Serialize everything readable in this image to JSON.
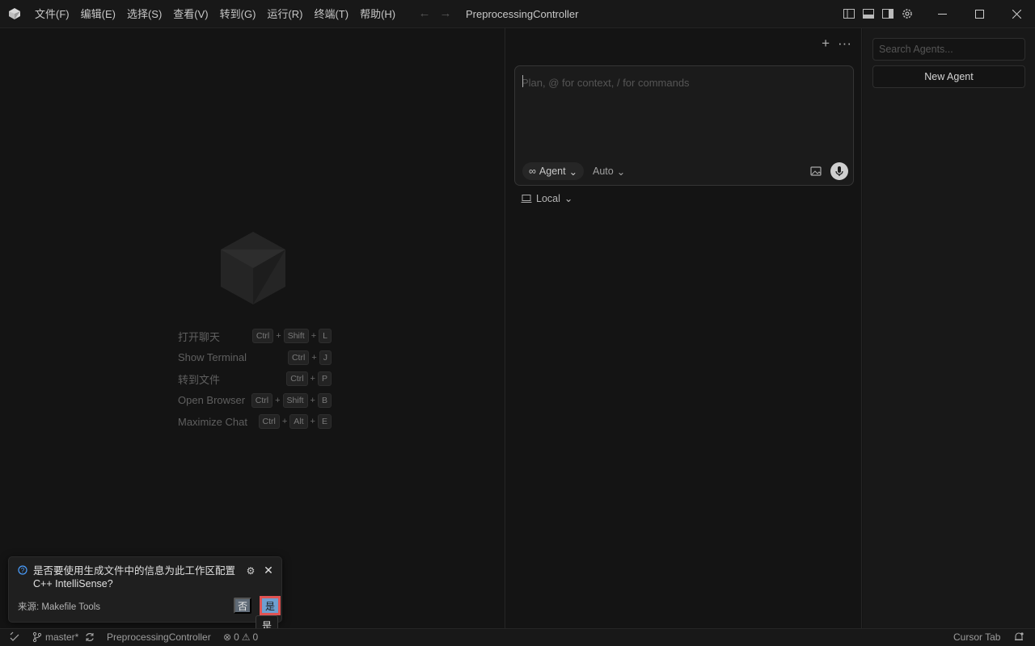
{
  "menu": {
    "items": [
      "文件(F)",
      "编辑(E)",
      "选择(S)",
      "查看(V)",
      "转到(G)",
      "运行(R)",
      "终端(T)",
      "帮助(H)"
    ]
  },
  "window": {
    "title": "PreprocessingController"
  },
  "welcome": {
    "shortcuts": [
      {
        "label": "打开聊天",
        "keys": [
          "Ctrl",
          "Shift",
          "L"
        ]
      },
      {
        "label": "Show Terminal",
        "keys": [
          "Ctrl",
          "J"
        ]
      },
      {
        "label": "转到文件",
        "keys": [
          "Ctrl",
          "P"
        ]
      },
      {
        "label": "Open Browser",
        "keys": [
          "Ctrl",
          "Shift",
          "B"
        ]
      },
      {
        "label": "Maximize Chat",
        "keys": [
          "Ctrl",
          "Alt",
          "E"
        ]
      }
    ],
    "plus_sign": "+"
  },
  "chat": {
    "placeholder": "Plan, @ for context, / for commands",
    "mode": "Agent",
    "model": "Auto",
    "environment": "Local",
    "new_chat_icon": "plus-icon",
    "more_icon": "ellipsis-icon"
  },
  "agents": {
    "search_placeholder": "Search Agents...",
    "new_agent_label": "New Agent"
  },
  "notification": {
    "message": "是否要使用生成文件中的信息为此工作区配置 C++ IntelliSense?",
    "source": "来源: Makefile Tools",
    "no_label": "否",
    "yes_label": "是",
    "tooltip": "是"
  },
  "status": {
    "branch": "master*",
    "project": "PreprocessingController",
    "errors": "0",
    "warnings": "0",
    "cursor_tab": "Cursor Tab"
  },
  "colors": {
    "accent_button": "#6e9fd0",
    "highlight_border": "#e05353",
    "info_icon": "#4a9eff"
  }
}
